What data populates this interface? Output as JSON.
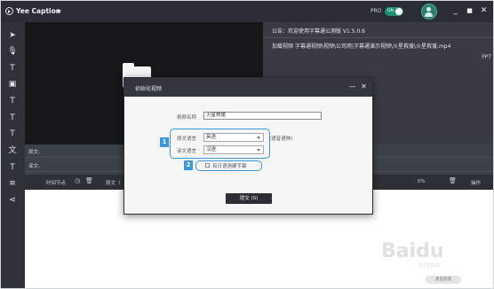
{
  "app": {
    "title": "Yee Caption"
  },
  "header": {
    "pro_label": "PRO",
    "toggle_label": "ON",
    "minimize": "_",
    "maximize": "■",
    "close": "✕"
  },
  "toolbar": {
    "items": [
      {
        "icon": "pointer-icon",
        "glyph": "➤"
      },
      {
        "icon": "microphone-icon",
        "glyph": "🎙"
      },
      {
        "icon": "text-tool-icon",
        "glyph": "T"
      },
      {
        "icon": "caption-box-icon",
        "glyph": "▣"
      },
      {
        "icon": "voice-text-icon",
        "glyph": "T"
      },
      {
        "icon": "text-frame-icon",
        "glyph": "T"
      },
      {
        "icon": "text-style-icon",
        "glyph": "T"
      },
      {
        "icon": "translate-icon",
        "glyph": "文"
      },
      {
        "icon": "subtitle-tool-icon",
        "glyph": "T"
      },
      {
        "icon": "list-icon",
        "glyph": "≡"
      },
      {
        "icon": "share-icon",
        "glyph": "⋖"
      }
    ]
  },
  "right_panel": {
    "notice": "公告：欢迎使用字幕通公测版 V1.5.0.6",
    "loading_prefix": "加载视频",
    "loading_blur": "               ",
    "loading_path": "字幕通视频\\视频\\公司用\\字幕通演示视频\\火星救援\\火星救援.mp4",
    "ppt": "PPT"
  },
  "subtitle_area": {
    "source_label": "原文:",
    "translated_label": "译文:"
  },
  "timeline": {
    "time_node": "时间节点",
    "source_col": "原文（",
    "progress": "0%",
    "action": "操作"
  },
  "dialog": {
    "title": "初始化视频",
    "minimize": "—",
    "close": "✕",
    "video_name_label": "视频名称",
    "video_name_value": "火星救援",
    "source_lang_label": "原文语言",
    "source_lang_value": "英语",
    "source_lang_hint": "(语音语种)",
    "target_lang_label": "译文语言",
    "target_lang_value": "汉语",
    "hardcode_label": "有日语测硬字幕",
    "submit_label": "提交 (S)",
    "badge_1": "1",
    "badge_2": "2"
  },
  "footer": {
    "feedback": "意见反馈"
  },
  "watermark": {
    "text": "Baidu",
    "sub": "jingyan"
  }
}
